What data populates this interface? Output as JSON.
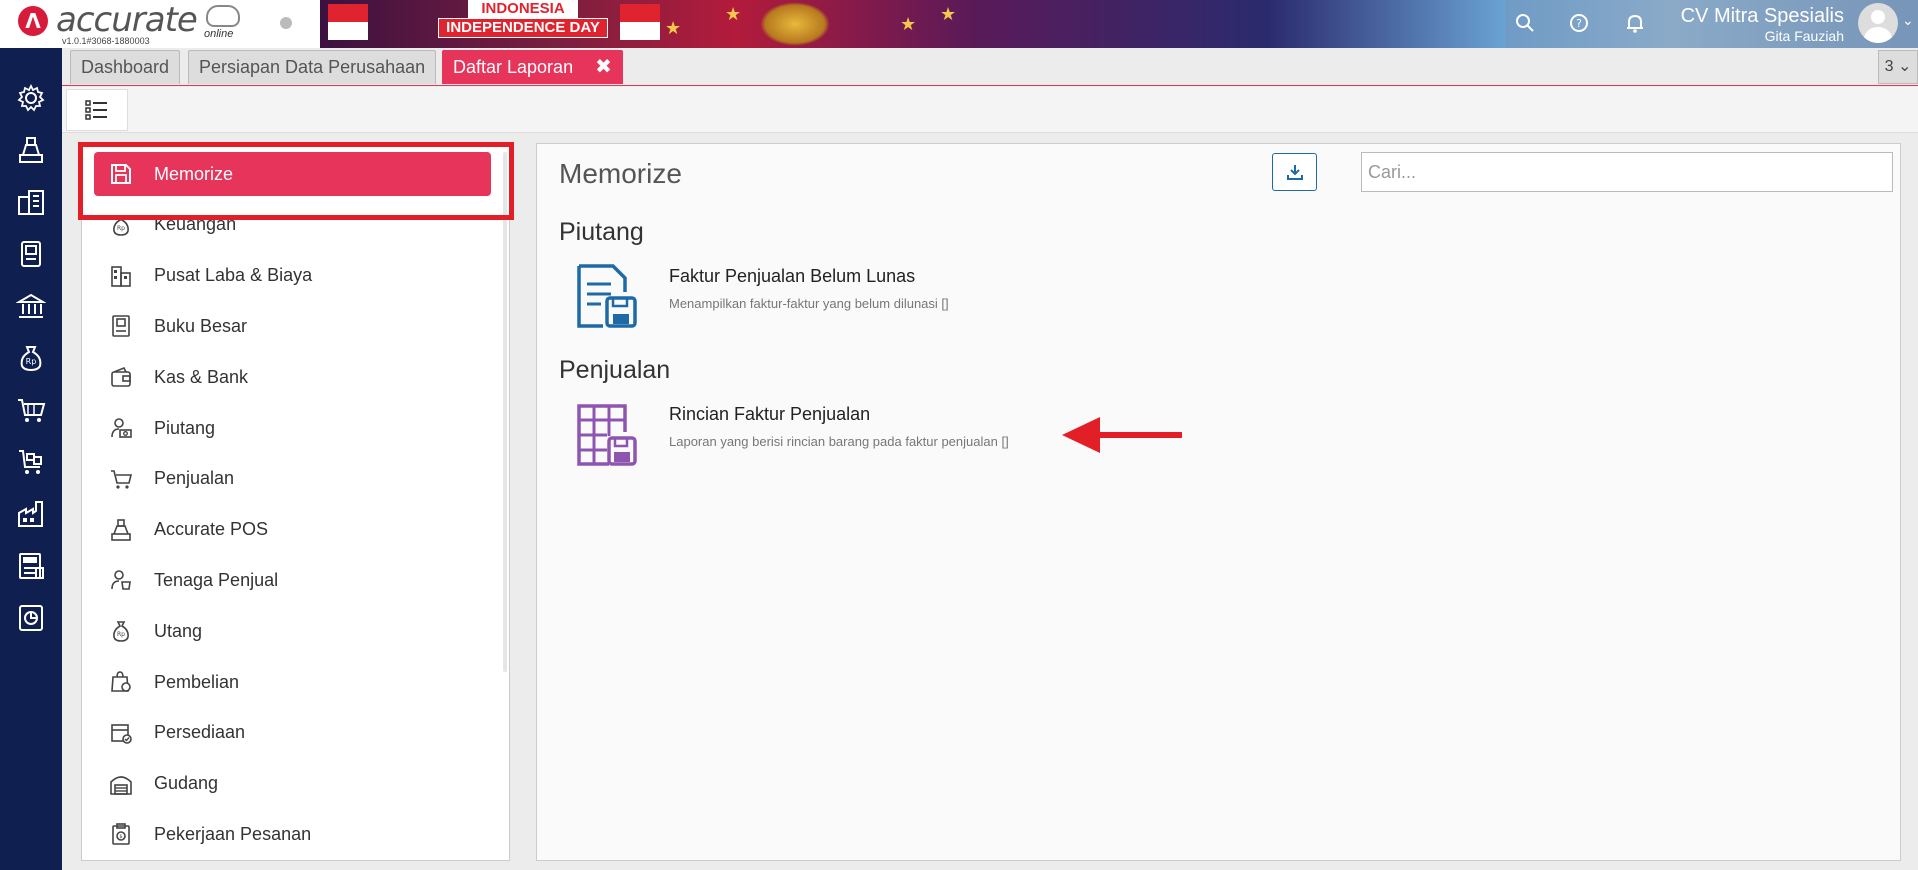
{
  "header": {
    "logo_text": "accurate",
    "logo_online": "online",
    "version": "v1.0.1#3068-1880003",
    "banner_line1": "INDONESIA",
    "banner_line2": "INDEPENDENCE DAY",
    "company_name": "CV Mitra Spesialis",
    "user_name": "Gita Fauziah",
    "icons": [
      "search-icon",
      "help-icon",
      "bell-icon"
    ]
  },
  "leftnav": {
    "icons": [
      "gear-icon",
      "cashier-icon",
      "building-icon",
      "ledger-icon",
      "bank-icon",
      "money-bag-icon",
      "cart-icon",
      "truck-icon",
      "factory-icon",
      "tax-icon",
      "report-icon"
    ]
  },
  "tabs": [
    {
      "label": "Dashboard"
    },
    {
      "label": "Persiapan Data Perusahaan"
    },
    {
      "label": "Daftar Laporan",
      "active": true
    }
  ],
  "tab_close": "✖",
  "tab_count": "3",
  "categories": [
    {
      "label": "Memorize",
      "active": true,
      "icon": "save-icon"
    },
    {
      "label": "Keuangan",
      "icon": "money-bag-icon"
    },
    {
      "label": "Pusat Laba & Biaya",
      "icon": "building-icon"
    },
    {
      "label": "Buku Besar",
      "icon": "ledger-icon"
    },
    {
      "label": "Kas & Bank",
      "icon": "wallet-icon"
    },
    {
      "label": "Piutang",
      "icon": "receivable-icon"
    },
    {
      "label": "Penjualan",
      "icon": "cart-icon"
    },
    {
      "label": "Accurate POS",
      "icon": "cashier-icon"
    },
    {
      "label": "Tenaga Penjual",
      "icon": "salesperson-icon"
    },
    {
      "label": "Utang",
      "icon": "payable-icon"
    },
    {
      "label": "Pembelian",
      "icon": "purchase-icon"
    },
    {
      "label": "Persediaan",
      "icon": "inventory-icon"
    },
    {
      "label": "Gudang",
      "icon": "warehouse-icon"
    },
    {
      "label": "Pekerjaan Pesanan",
      "icon": "job-order-icon"
    }
  ],
  "main": {
    "title": "Memorize",
    "search_placeholder": "Cari...",
    "sections": [
      {
        "title": "Piutang",
        "reports": [
          {
            "name": "Faktur Penjualan Belum Lunas",
            "desc": "Menampilkan faktur-faktur yang belum dilunasi []",
            "icon": "invoice-save-icon",
            "color": "#1e6aa7"
          }
        ]
      },
      {
        "title": "Penjualan",
        "reports": [
          {
            "name": "Rincian Faktur Penjualan",
            "desc": "Laporan yang berisi rincian barang pada faktur penjualan []",
            "icon": "table-save-icon",
            "color": "#8e55b0"
          }
        ]
      }
    ]
  },
  "colors": {
    "accent": "#e6345a",
    "nav_bg": "#0f1f4f",
    "annotation_red": "#e21f26"
  }
}
